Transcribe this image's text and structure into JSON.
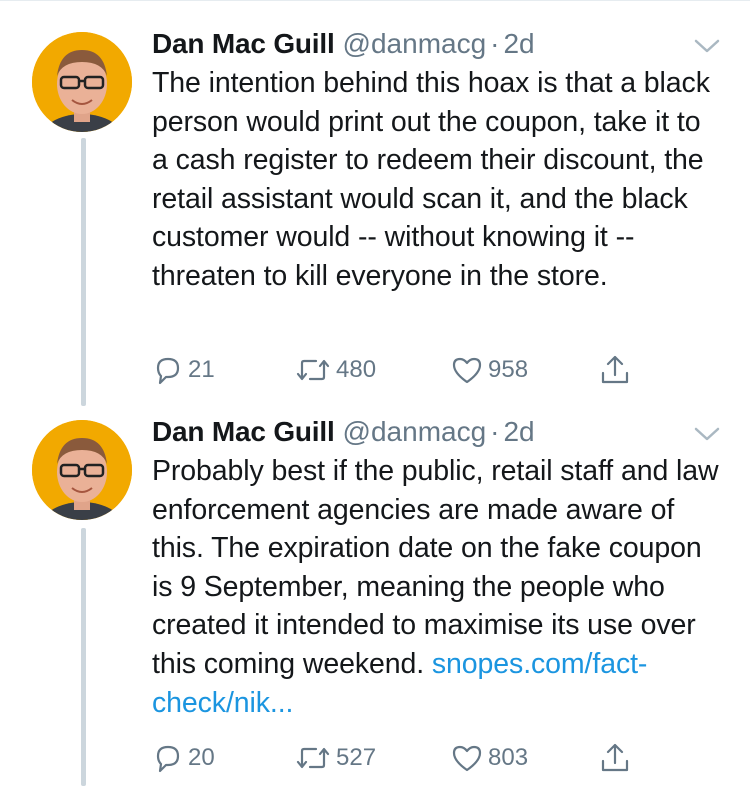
{
  "colors": {
    "avatar_bg": "#f2a900",
    "thread_line": "#ccd6dd",
    "secondary_text": "#657786",
    "link": "#1b95e0"
  },
  "tweets": [
    {
      "author_name": "Dan Mac Guill",
      "handle": "@danmacg",
      "separator": "·",
      "time": "2d",
      "text": "The intention behind this hoax is that a black person would print out the coupon, take it to a cash register to redeem their discount, the retail assistant would scan it, and the black customer would -- without knowing it -- threaten to kill everyone in the store.",
      "link": "",
      "replies": "21",
      "retweets": "480",
      "likes": "958",
      "icons": [
        "reply-icon",
        "retweet-icon",
        "like-icon",
        "share-icon",
        "caret-down-icon"
      ]
    },
    {
      "author_name": "Dan Mac Guill",
      "handle": "@danmacg",
      "separator": "·",
      "time": "2d",
      "text": "Probably best if the public, retail staff and law enforcement agencies are made aware of this. The expiration date on the fake coupon is 9 September, meaning the people who created it intended to maximise its use over this coming weekend. ",
      "link": "snopes.com/fact-check/nik...",
      "replies": "20",
      "retweets": "527",
      "likes": "803",
      "icons": [
        "reply-icon",
        "retweet-icon",
        "like-icon",
        "share-icon",
        "caret-down-icon"
      ]
    }
  ]
}
